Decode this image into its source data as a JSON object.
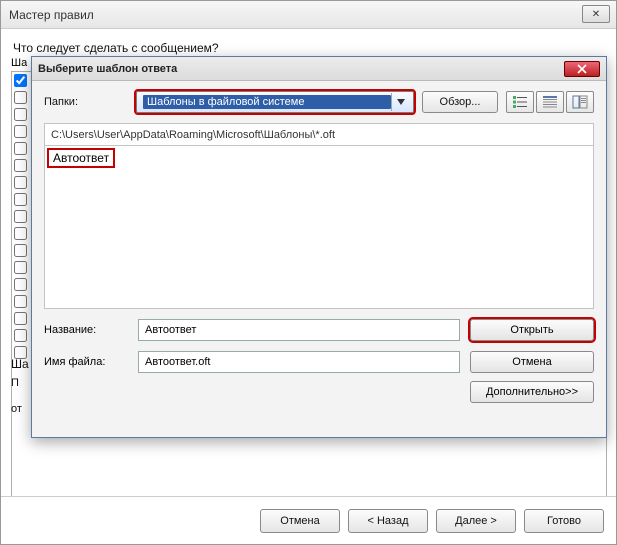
{
  "outer": {
    "title": "Мастер правил",
    "question": "Что следует сделать с сообщением?",
    "step1_short": "Ша",
    "step2_short": "Ша",
    "step2_para": "П",
    "step2_from": "от"
  },
  "footer": {
    "cancel": "Отмена",
    "back": "< Назад",
    "next": "Далее >",
    "finish": "Готово"
  },
  "modal": {
    "title": "Выберите шаблон ответа",
    "folders_label": "Папки:",
    "folders_selected": "Шаблоны в файловой системе",
    "browse": "Обзор...",
    "path": "C:\\Users\\User\\AppData\\Roaming\\Microsoft\\Шаблоны\\*.oft",
    "file_item": "Автоответ",
    "name_label": "Название:",
    "name_value": "Автоответ",
    "filename_label": "Имя файла:",
    "filename_value": "Автоответ.oft",
    "open": "Открыть",
    "cancel": "Отмена",
    "advanced": "Дополнительно>>"
  }
}
